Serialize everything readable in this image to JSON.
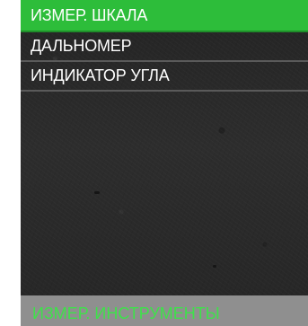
{
  "menu": {
    "items": [
      {
        "label": "ИЗМЕР. ШКАЛА",
        "selected": true
      },
      {
        "label": "ДАЛЬНОМЕР",
        "selected": false
      },
      {
        "label": "ИНДИКАТОР УГЛА",
        "selected": false
      }
    ]
  },
  "footer": {
    "title": "ИЗМЕР. ИНСТРУМЕНТЫ"
  },
  "colors": {
    "selected_bg": "#2dbd3a",
    "footer_bg": "#8f8f8f",
    "footer_text": "#3ee24a"
  }
}
